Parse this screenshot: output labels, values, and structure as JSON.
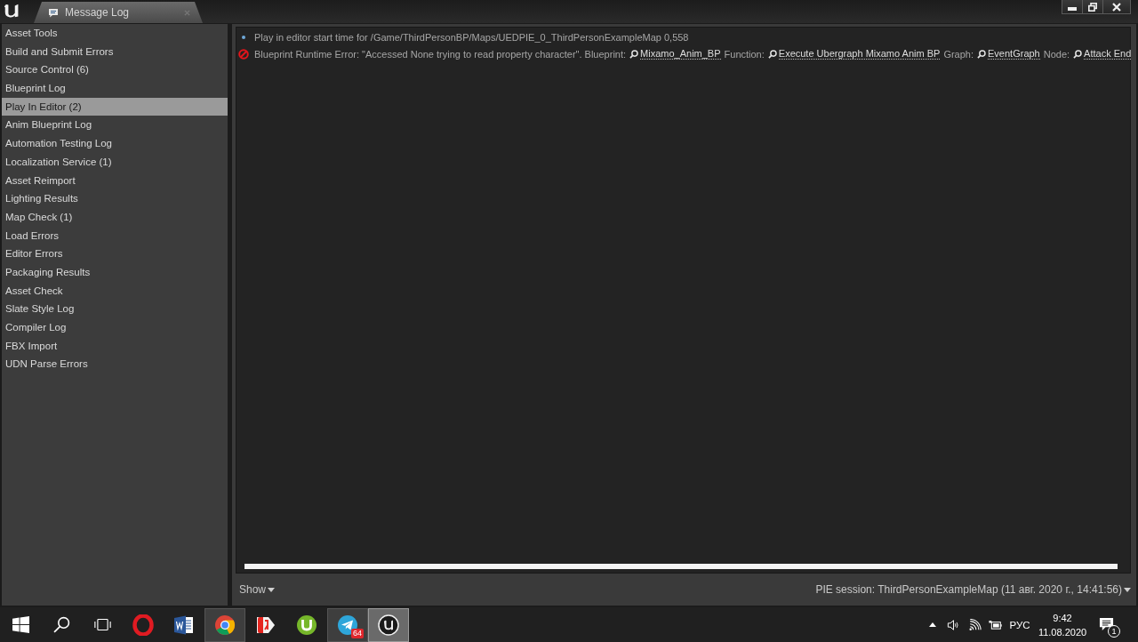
{
  "tab": {
    "title": "Message Log"
  },
  "sidebar": {
    "items": [
      {
        "label": "Asset Tools",
        "selected": false
      },
      {
        "label": "Build and Submit Errors",
        "selected": false
      },
      {
        "label": "Source Control (6)",
        "selected": false
      },
      {
        "label": "Blueprint Log",
        "selected": false
      },
      {
        "label": "Play In Editor (2)",
        "selected": true
      },
      {
        "label": "Anim Blueprint Log",
        "selected": false
      },
      {
        "label": "Automation Testing Log",
        "selected": false
      },
      {
        "label": "Localization Service (1)",
        "selected": false
      },
      {
        "label": "Asset Reimport",
        "selected": false
      },
      {
        "label": "Lighting Results",
        "selected": false
      },
      {
        "label": "Map Check (1)",
        "selected": false
      },
      {
        "label": "Load Errors",
        "selected": false
      },
      {
        "label": "Editor Errors",
        "selected": false
      },
      {
        "label": "Packaging Results",
        "selected": false
      },
      {
        "label": "Asset Check",
        "selected": false
      },
      {
        "label": "Slate Style Log",
        "selected": false
      },
      {
        "label": "Compiler Log",
        "selected": false
      },
      {
        "label": "FBX Import",
        "selected": false
      },
      {
        "label": "UDN Parse Errors",
        "selected": false
      }
    ]
  },
  "log": {
    "messages": [
      {
        "kind": "info",
        "parts": [
          {
            "kind": "text",
            "text": "Play in editor start time for /Game/ThirdPersonBP/Maps/UEDPIE_0_ThirdPersonExampleMap 0,558"
          }
        ]
      },
      {
        "kind": "error",
        "parts": [
          {
            "kind": "text",
            "text": "Blueprint Runtime Error: \"Accessed None trying to read property character\". Blueprint:"
          },
          {
            "kind": "link",
            "text": "Mixamo_Anim_BP"
          },
          {
            "kind": "text",
            "text": "Function:"
          },
          {
            "kind": "link",
            "text": "Execute Ubergraph Mixamo Anim BP"
          },
          {
            "kind": "text",
            "text": "Graph:"
          },
          {
            "kind": "link",
            "text": "EventGraph"
          },
          {
            "kind": "text",
            "text": "Node:"
          },
          {
            "kind": "link",
            "text": "Attack End"
          }
        ]
      }
    ]
  },
  "footer": {
    "show_button": "Show",
    "session": "PIE session: ThirdPersonExampleMap (11 авг. 2020 г., 14:41:56)"
  },
  "taskbar": {
    "apps": [
      {
        "kind": "opera",
        "running": false,
        "active": false
      },
      {
        "kind": "word",
        "running": false,
        "active": false
      },
      {
        "kind": "chrome",
        "running": true,
        "active": false
      },
      {
        "kind": "yandex",
        "running": false,
        "active": false
      },
      {
        "kind": "utorrent",
        "running": false,
        "active": false
      },
      {
        "kind": "telegram",
        "running": true,
        "active": false,
        "badge": "64"
      },
      {
        "kind": "unreal",
        "running": true,
        "active": true
      }
    ],
    "language": "РУС",
    "time": "9:42",
    "date": "11.08.2020",
    "notifications": "1"
  }
}
